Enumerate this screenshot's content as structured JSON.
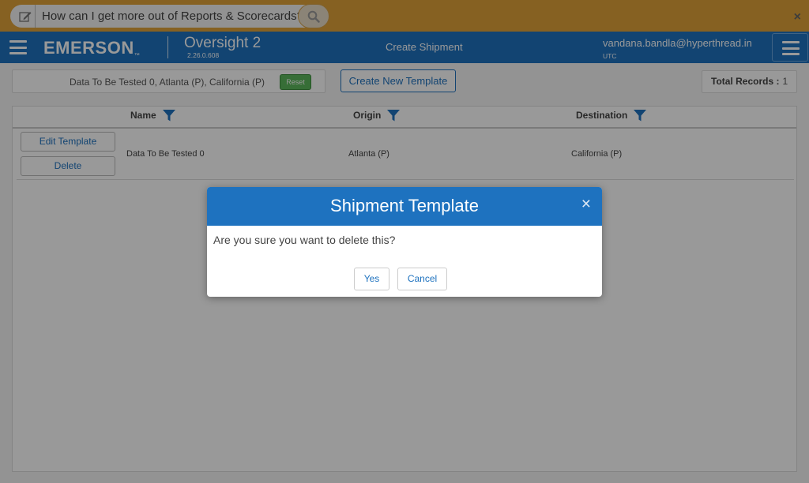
{
  "banner": {
    "ask_text": "How can I get more out of Reports & Scorecards?",
    "close_label": "×"
  },
  "header": {
    "brand": "EMERSON",
    "brand_tm": "™",
    "app_name": "Oversight 2",
    "version": "2.26.0.608",
    "page_title": "Create Shipment",
    "user_email": "vandana.bandla@hyperthread.in",
    "timezone": "UTC"
  },
  "toolbar": {
    "filter_summary": "Data To Be Tested 0, Atlanta (P), California (P)",
    "reset_label": "Reset",
    "new_template_label": "Create New Template",
    "total_label": "Total Records :",
    "total_value": "1"
  },
  "grid": {
    "columns": [
      {
        "label": "Name"
      },
      {
        "label": "Origin"
      },
      {
        "label": "Destination"
      }
    ],
    "rows": [
      {
        "edit_label": "Edit Template",
        "delete_label": "Delete",
        "name": "Data To Be Tested 0",
        "origin": "Atlanta (P)",
        "destination": "California (P)"
      }
    ]
  },
  "modal": {
    "title": "Shipment Template",
    "close_label": "×",
    "message": "Are you sure you want to delete this?",
    "yes_label": "Yes",
    "cancel_label": "Cancel"
  },
  "colors": {
    "banner": "#e0a23a",
    "header": "#1e72bf",
    "reset_green": "#5cb85c"
  },
  "icons": [
    "edit-icon",
    "search-icon",
    "close-icon",
    "hamburger-icon",
    "filter-icon"
  ]
}
